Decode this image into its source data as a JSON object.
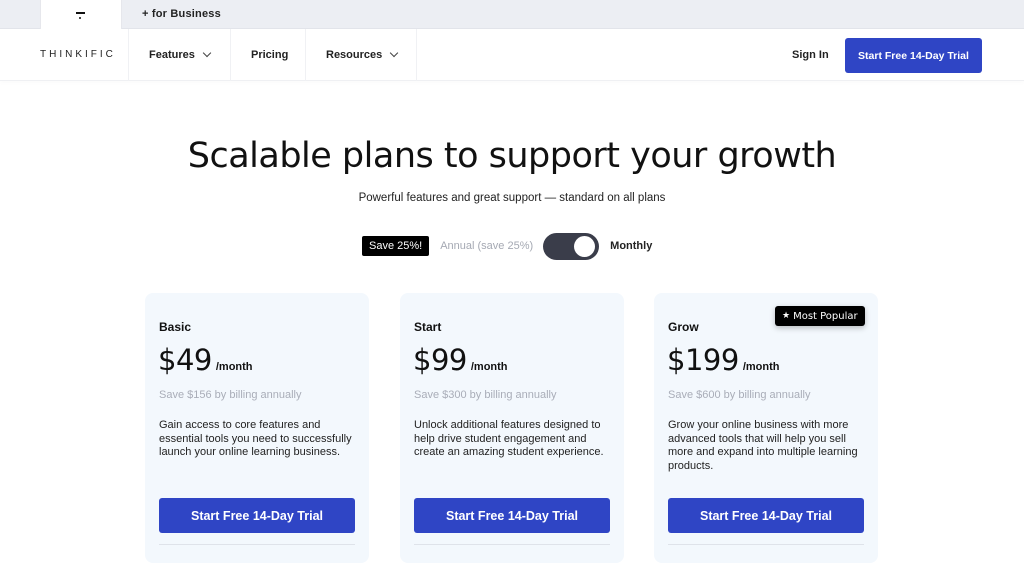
{
  "topbar": {
    "home_tab_icon": "thinkific-logo-mark",
    "business_tab": "+ for Business"
  },
  "nav": {
    "brand": "THINKIFIC",
    "items": [
      {
        "label": "Features",
        "has_dropdown": true
      },
      {
        "label": "Pricing",
        "has_dropdown": false
      },
      {
        "label": "Resources",
        "has_dropdown": true
      }
    ],
    "sign_in": "Sign In",
    "cta": "Start Free 14-Day Trial"
  },
  "hero": {
    "title": "Scalable plans to support your growth",
    "subtitle": "Powerful features and great support — standard on all plans"
  },
  "billing_toggle": {
    "save_badge": "Save 25%!",
    "annual_label": "Annual (save 25%)",
    "monthly_label": "Monthly",
    "selected": "Monthly"
  },
  "plans": [
    {
      "name": "Basic",
      "price": "$49",
      "period": "/month",
      "save_note": "Save $156 by billing annually",
      "description": "Gain access to core features and essential tools you need to successfully launch your online learning business.",
      "cta": "Start Free 14-Day Trial"
    },
    {
      "name": "Start",
      "price": "$99",
      "period": "/month",
      "save_note": "Save $300 by billing annually",
      "description": "Unlock additional features designed to help drive student engagement and create an amazing student experience.",
      "cta": "Start Free 14-Day Trial"
    },
    {
      "name": "Grow",
      "price": "$199",
      "period": "/month",
      "save_note": "Save $600 by billing annually",
      "description": "Grow your online business with more advanced tools that will help you sell more and expand into multiple learning products.",
      "cta": "Start Free 14-Day Trial",
      "badge": "Most Popular",
      "badge_icon": "star-icon"
    }
  ],
  "colors": {
    "primary": "#2f45c5",
    "card_bg": "#f3f8fd",
    "badge_bg": "#000000",
    "toggle_bg": "#3a3d4a",
    "muted_text": "#a9adb8"
  }
}
